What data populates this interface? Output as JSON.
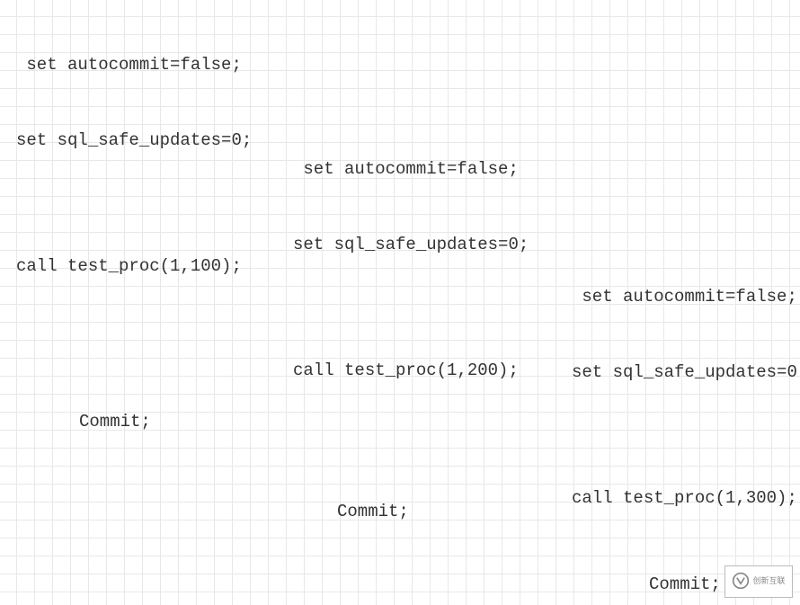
{
  "blocks": {
    "session1": {
      "line1": " set autocommit=false;",
      "line2": "set sql_safe_updates=0;",
      "line3": "",
      "line4": "call test_proc(1,100);"
    },
    "session2": {
      "line1": " set autocommit=false;",
      "line2": "set sql_safe_updates=0;",
      "line3": "",
      "line4": "call test_proc(1,200);"
    },
    "session3": {
      "line1": " set autocommit=false;",
      "line2": "set sql_safe_updates=0;",
      "line3": "",
      "line4": "call test_proc(1,300);"
    },
    "commit1": "Commit;",
    "commit2": "Commit;",
    "commit3": "Commit;"
  },
  "watermark": {
    "brand": "创新互联"
  }
}
